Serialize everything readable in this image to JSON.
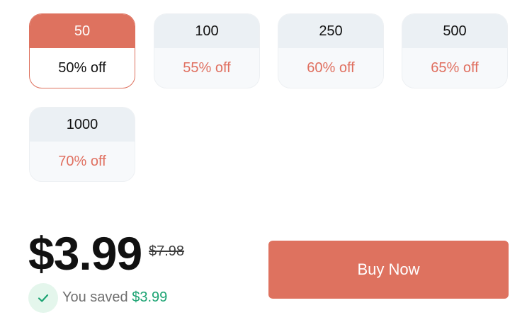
{
  "tiers": [
    {
      "quantity": "50",
      "discount": "50% off",
      "selected": true
    },
    {
      "quantity": "100",
      "discount": "55% off",
      "selected": false
    },
    {
      "quantity": "250",
      "discount": "60% off",
      "selected": false
    },
    {
      "quantity": "500",
      "discount": "65% off",
      "selected": false
    },
    {
      "quantity": "1000",
      "discount": "70% off",
      "selected": false
    }
  ],
  "pricing": {
    "price": "$3.99",
    "original_price": "$7.98",
    "saved_prefix": "You saved",
    "saved_amount": "$3.99",
    "check_icon": "check-icon"
  },
  "buy_button": {
    "label": "Buy Now"
  },
  "colors": {
    "accent": "#de725f",
    "discount_text": "#e07060",
    "success": "#1ba372",
    "success_bg": "#e4f6ec",
    "tier_header_bg": "#ebf0f4"
  }
}
